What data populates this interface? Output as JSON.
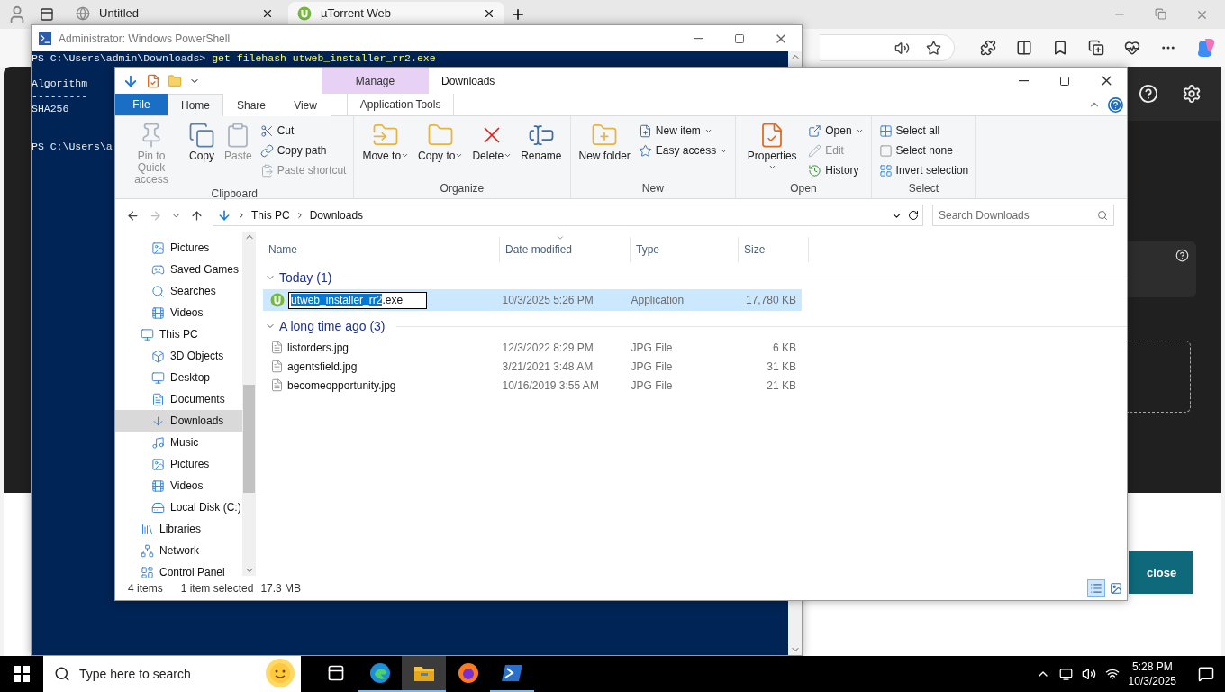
{
  "browser": {
    "tabs": [
      {
        "title": "Untitled",
        "selected": false
      },
      {
        "title": "µTorrent Web",
        "selected": true
      }
    ],
    "page_button": {
      "label": "close"
    }
  },
  "powershell": {
    "title": "Administrator: Windows PowerShell",
    "lines": [
      {
        "kind": "command",
        "prompt": "PS C:\\Users\\admin\\Downloads> ",
        "command": "get-filehash utweb_installer_rr2.exe"
      },
      {
        "kind": "blank"
      },
      {
        "kind": "output",
        "text": "Algorithm"
      },
      {
        "kind": "output",
        "text": "---------"
      },
      {
        "kind": "output",
        "text": "SHA256"
      },
      {
        "kind": "blank"
      },
      {
        "kind": "blank"
      },
      {
        "kind": "output",
        "text": "PS C:\\Users\\a"
      }
    ]
  },
  "explorer": {
    "title": "Downloads",
    "context_tab": {
      "group": "Manage",
      "label": "Application Tools",
      "selected": false
    },
    "tabs": [
      {
        "label": "File",
        "kind": "menu",
        "selected": false
      },
      {
        "label": "Home",
        "kind": "tab",
        "selected": true
      },
      {
        "label": "Share",
        "kind": "tab",
        "selected": false
      },
      {
        "label": "View",
        "kind": "tab",
        "selected": false
      }
    ],
    "ribbon": [
      {
        "name": "Clipboard",
        "buttons": [
          {
            "label": "Pin to Quick access",
            "kind": "large",
            "disabled": true,
            "dropdown": false
          },
          {
            "label": "Copy",
            "kind": "large",
            "disabled": false,
            "dropdown": false
          },
          {
            "label": "Paste",
            "kind": "large",
            "disabled": true,
            "dropdown": false
          },
          {
            "label": "Cut",
            "kind": "small",
            "disabled": false,
            "dropdown": false
          },
          {
            "label": "Copy path",
            "kind": "small",
            "disabled": false,
            "dropdown": false
          },
          {
            "label": "Paste shortcut",
            "kind": "small",
            "disabled": true,
            "dropdown": false
          }
        ]
      },
      {
        "name": "Organize",
        "buttons": [
          {
            "label": "Move to",
            "kind": "large",
            "disabled": false,
            "dropdown": true
          },
          {
            "label": "Copy to",
            "kind": "large",
            "disabled": false,
            "dropdown": true
          },
          {
            "label": "Delete",
            "kind": "large",
            "disabled": false,
            "dropdown": true
          },
          {
            "label": "Rename",
            "kind": "large",
            "disabled": false,
            "dropdown": false
          }
        ]
      },
      {
        "name": "New",
        "buttons": [
          {
            "label": "New folder",
            "kind": "large",
            "disabled": false,
            "dropdown": false
          },
          {
            "label": "New item",
            "kind": "small",
            "disabled": false,
            "dropdown": true
          },
          {
            "label": "Easy access",
            "kind": "small",
            "disabled": false,
            "dropdown": true
          }
        ]
      },
      {
        "name": "Open",
        "buttons": [
          {
            "label": "Properties",
            "kind": "large",
            "disabled": false,
            "dropdown": true
          },
          {
            "label": "Open",
            "kind": "small",
            "disabled": false,
            "dropdown": true
          },
          {
            "label": "Edit",
            "kind": "small",
            "disabled": true,
            "dropdown": false
          },
          {
            "label": "History",
            "kind": "small",
            "disabled": false,
            "dropdown": false
          }
        ]
      },
      {
        "name": "Select",
        "buttons": [
          {
            "label": "Select all",
            "kind": "small",
            "disabled": false,
            "dropdown": false
          },
          {
            "label": "Select none",
            "kind": "small",
            "disabled": false,
            "dropdown": false
          },
          {
            "label": "Invert selection",
            "kind": "small",
            "disabled": false,
            "dropdown": false
          }
        ]
      }
    ],
    "address": {
      "path": [
        "This PC",
        "Downloads"
      ]
    },
    "search": {
      "placeholder": "Search Downloads"
    },
    "nav": {
      "continued_items": [
        {
          "label": "Pictures",
          "selected": false
        },
        {
          "label": "Saved Games",
          "selected": false
        },
        {
          "label": "Searches",
          "selected": false
        },
        {
          "label": "Videos",
          "selected": false
        }
      ],
      "items": [
        {
          "label": "This PC",
          "selected": false,
          "children": [
            {
              "label": "3D Objects",
              "selected": false
            },
            {
              "label": "Desktop",
              "selected": false
            },
            {
              "label": "Documents",
              "selected": false
            },
            {
              "label": "Downloads",
              "selected": true
            },
            {
              "label": "Music",
              "selected": false
            },
            {
              "label": "Pictures",
              "selected": false
            },
            {
              "label": "Videos",
              "selected": false
            },
            {
              "label": "Local Disk (C:)",
              "selected": false
            }
          ]
        },
        {
          "label": "Libraries",
          "selected": false
        },
        {
          "label": "Network",
          "selected": false
        },
        {
          "label": "Control Panel",
          "selected": false
        }
      ]
    },
    "columns": [
      {
        "label": "Name",
        "sorted": false
      },
      {
        "label": "Date modified",
        "sorted": true
      },
      {
        "label": "Type",
        "sorted": false
      },
      {
        "label": "Size",
        "sorted": false
      }
    ],
    "groups": [
      {
        "label": "Today (1)",
        "expanded": true,
        "files": [
          {
            "name": "utweb_installer_rr2",
            "extension": ".exe",
            "kind": "app",
            "date": "10/3/2025 5:26 PM",
            "type": "Application",
            "size": "17,780 KB",
            "selected": true,
            "renaming": true
          }
        ]
      },
      {
        "label": "A long time ago (3)",
        "expanded": true,
        "files": [
          {
            "name": "listorders",
            "extension": ".jpg",
            "kind": "image",
            "date": "12/3/2022 8:29 PM",
            "type": "JPG File",
            "size": "6 KB",
            "selected": false,
            "renaming": false
          },
          {
            "name": "agentsfield",
            "extension": ".jpg",
            "kind": "image",
            "date": "3/21/2021 3:48 AM",
            "type": "JPG File",
            "size": "31 KB",
            "selected": false,
            "renaming": false
          },
          {
            "name": "becomeopportunity",
            "extension": ".jpg",
            "kind": "image",
            "date": "10/16/2019 3:55 AM",
            "type": "JPG File",
            "size": "21 KB",
            "selected": false,
            "renaming": false
          }
        ]
      }
    ],
    "status": {
      "count": "4 items",
      "selection": "1 item selected",
      "size": "17.3 MB"
    },
    "views": [
      {
        "kind": "details",
        "selected": true
      },
      {
        "kind": "large-icons",
        "selected": false
      }
    ]
  },
  "taskbar": {
    "search": {
      "placeholder": "Type here to search"
    },
    "apps": [
      {
        "kind": "taskview",
        "running": false,
        "selected": false
      },
      {
        "kind": "edge",
        "running": true,
        "selected": false
      },
      {
        "kind": "explorer",
        "running": true,
        "selected": true
      },
      {
        "kind": "firefox",
        "running": false,
        "selected": false
      },
      {
        "kind": "powershell",
        "running": true,
        "selected": false
      }
    ],
    "clock": {
      "time": "5:28 PM",
      "date": "10/3/2025"
    }
  }
}
